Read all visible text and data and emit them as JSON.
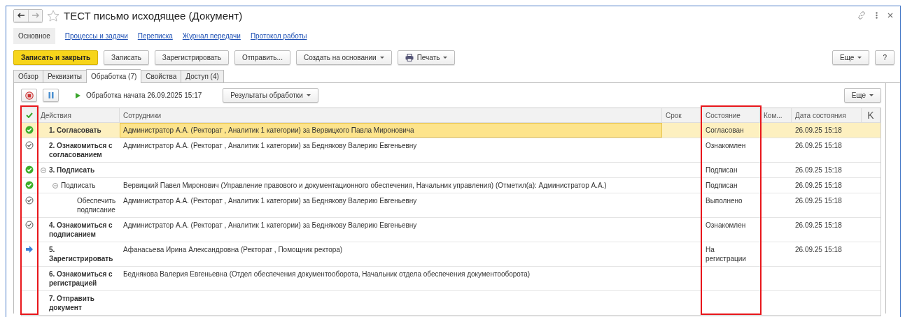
{
  "window": {
    "title": "ТЕСТ письмо исходящее (Документ)"
  },
  "nav": [
    {
      "label": "Основное",
      "selected": true
    },
    {
      "label": "Процессы и задачи",
      "selected": false
    },
    {
      "label": "Переписка",
      "selected": false
    },
    {
      "label": "Журнал передачи",
      "selected": false
    },
    {
      "label": "Протокол работы",
      "selected": false
    }
  ],
  "toolbar": [
    {
      "label": "Записать и закрыть",
      "kind": "default"
    },
    {
      "label": "Записать",
      "kind": "plain"
    },
    {
      "label": "Зарегистрировать",
      "kind": "plain"
    },
    {
      "label": "Отправить...",
      "kind": "plain"
    },
    {
      "label": "Создать на основании",
      "kind": "dropdown"
    },
    {
      "label": "Печать",
      "kind": "print"
    }
  ],
  "toolbar_right": [
    {
      "label": "Еще",
      "kind": "dropdown"
    },
    {
      "label": "?",
      "kind": "plain"
    }
  ],
  "tabs": [
    {
      "label": "Обзор",
      "selected": false
    },
    {
      "label": "Реквизиты",
      "selected": false
    },
    {
      "label": "Обработка (7)",
      "selected": true
    },
    {
      "label": "Свойства",
      "selected": false
    },
    {
      "label": "Доступ (4)",
      "selected": false
    }
  ],
  "processing": {
    "status": "Обработка начата 26.09.2025 15:17",
    "results_button": "Результаты обработки",
    "more_button": "Еще"
  },
  "table": {
    "columns": [
      {
        "kind": "icon",
        "highlighted": true
      },
      {
        "label": "Действия",
        "highlighted": false
      },
      {
        "label": "Сотрудники",
        "highlighted": false
      },
      {
        "label": "Срок",
        "highlighted": false
      },
      {
        "label": "Состояние",
        "highlighted": true
      },
      {
        "label": "Ком...",
        "highlighted": false
      },
      {
        "label": "Дата состояния",
        "highlighted": false
      },
      {
        "label": "K",
        "highlighted": false
      }
    ],
    "rows": [
      {
        "kind": "done",
        "action": "1. Согласовать",
        "employees": "Администратор А.А. (Ректорат , Аналитик 1 категории) за Вервицкого Павла Мироновича",
        "state": "Согласован",
        "date": "26.09.25 15:18",
        "selected": true
      },
      {
        "kind": "checked",
        "action": "2. Ознакомиться с согласованием",
        "employees": "Администратор А.А. (Ректорат , Аналитик 1 категории) за Беднякову Валерию Евгеньевну",
        "state": "Ознакомлен",
        "date": "26.09.25 15:18",
        "selected": false
      },
      {
        "kind": "done",
        "action": "3. Подписать",
        "state": "Подписан",
        "date": "26.09.25 15:18",
        "selected": false,
        "expanded": true,
        "children": [
          {
            "kind": "done",
            "action": "Подписать",
            "employees": "Вервицкий Павел Миронович (Управление правового и документационного обеспечения, Начальник управления) (Отметил(а): Администратор А.А.)",
            "state": "Подписан",
            "date": "26.09.25 15:18",
            "selected": false,
            "expanded": true,
            "children": [
              {
                "kind": "checked",
                "action": "Обеспечить подписание",
                "employees": "Администратор А.А. (Ректорат , Аналитик 1 категории) за Беднякову Валерию Евгеньевну",
                "state": "Выполнено",
                "date": "26.09.25 15:18",
                "selected": false
              }
            ]
          }
        ]
      },
      {
        "kind": "checked",
        "action": "4. Ознакомиться с подписанием",
        "employees": "Администратор А.А. (Ректорат , Аналитик 1 категории) за Беднякову Валерию Евгеньевну",
        "state": "Ознакомлен",
        "date": "26.09.25 15:18",
        "selected": false
      },
      {
        "kind": "current",
        "action": "5. Зарегистрировать",
        "employees": "Афанасьева Ирина Александровна (Ректорат , Помощник ректора)",
        "state": "На регистрации",
        "date": "26.09.25 15:18",
        "selected": false
      },
      {
        "kind": "plain",
        "action": "6. Ознакомиться с регистрацией",
        "employees": "Беднякова Валерия Евгеньевна (Отдел обеспечения документооборота, Начальник отдела обеспечения документооборота)",
        "selected": false
      },
      {
        "kind": "plain",
        "action": "7. Отправить документ",
        "selected": false
      }
    ]
  }
}
